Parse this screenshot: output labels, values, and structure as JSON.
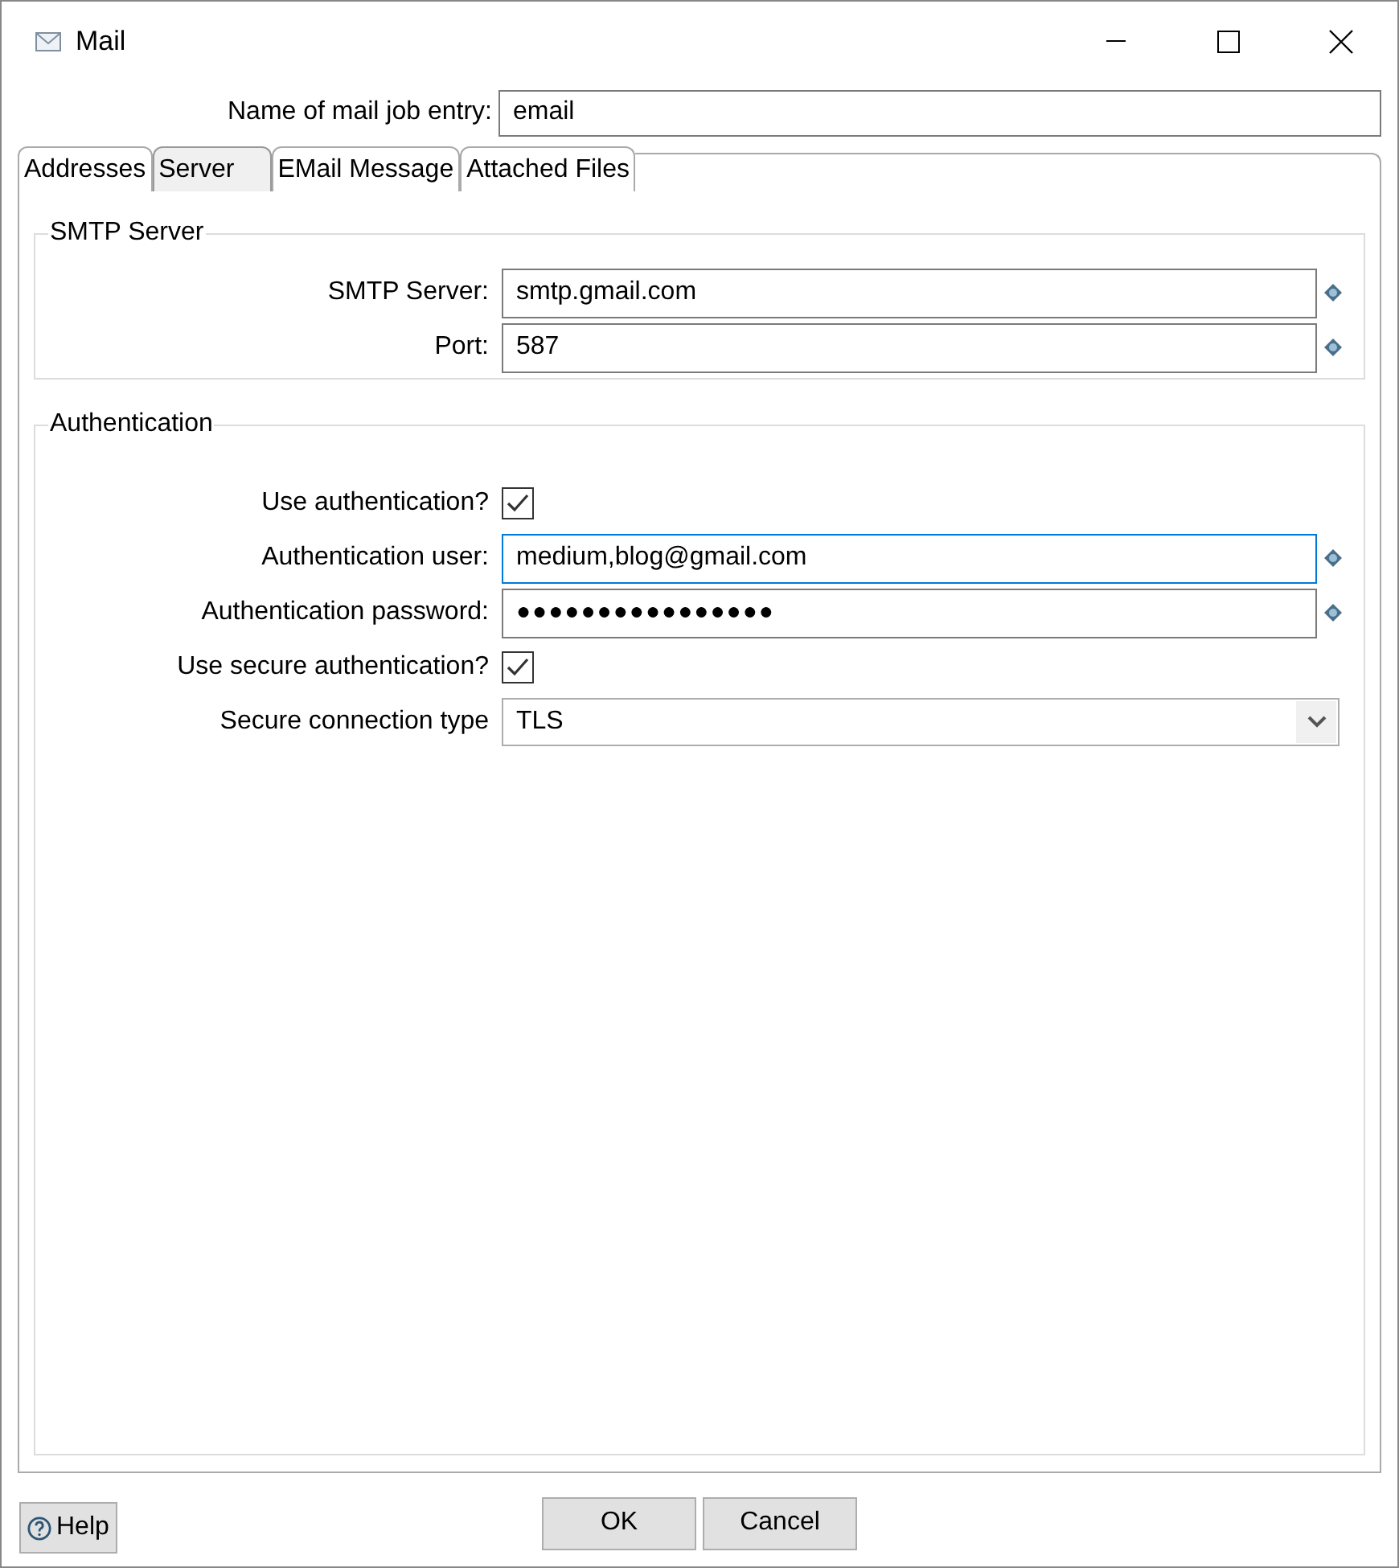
{
  "window": {
    "title": "Mail"
  },
  "name_field": {
    "label": "Name of mail job entry:",
    "value": "email"
  },
  "tabs": [
    {
      "label": "Addresses",
      "selected": false
    },
    {
      "label": "Server",
      "selected": true
    },
    {
      "label": "EMail Message",
      "selected": false
    },
    {
      "label": "Attached Files",
      "selected": false
    }
  ],
  "groups": [
    {
      "title": "SMTP Server",
      "fields": [
        {
          "kind": "text",
          "label": "SMTP Server:",
          "value": "smtp.gmail.com",
          "focused": false
        },
        {
          "kind": "text",
          "label": "Port:",
          "value": "587",
          "focused": false
        }
      ]
    },
    {
      "title": "Authentication",
      "fields": [
        {
          "kind": "checkbox",
          "label": "Use authentication?",
          "checked": true
        },
        {
          "kind": "text",
          "label": "Authentication user:",
          "value": "medium,blog@gmail.com",
          "focused": true
        },
        {
          "kind": "password",
          "label": "Authentication password:",
          "value": "●●●●●●●●●●●●●●●●",
          "focused": false
        },
        {
          "kind": "checkbox",
          "label": "Use secure authentication?",
          "checked": true
        },
        {
          "kind": "select",
          "label": "Secure connection type",
          "value": "TLS"
        }
      ]
    }
  ],
  "buttons": {
    "help": "Help",
    "ok": "OK",
    "cancel": "Cancel"
  }
}
